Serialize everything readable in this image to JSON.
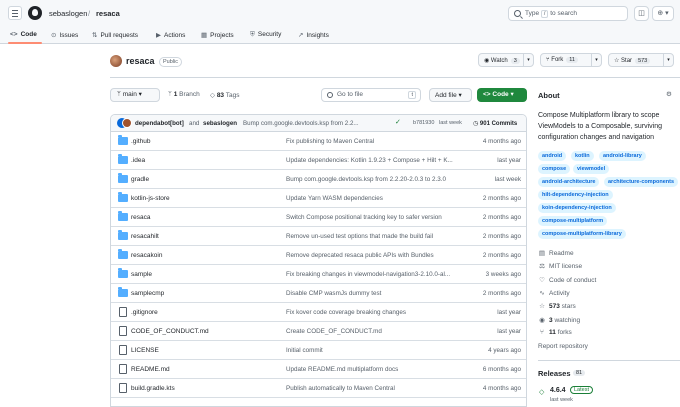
{
  "header": {
    "owner": "sebaslogen",
    "separator": "/",
    "repo": "resaca",
    "search_prefix": "Type",
    "search_key": "/",
    "search_suffix": "to search"
  },
  "tabs": [
    {
      "icon": "<>",
      "label": "Code"
    },
    {
      "icon": "⊙",
      "label": "Issues"
    },
    {
      "icon": "⇅",
      "label": "Pull requests"
    },
    {
      "icon": "▶",
      "label": "Actions"
    },
    {
      "icon": "▦",
      "label": "Projects"
    },
    {
      "icon": "⛨",
      "label": "Security"
    },
    {
      "icon": "↗",
      "label": "Insights"
    }
  ],
  "repo_header": {
    "name": "resaca",
    "visibility": "Public",
    "watch_label": "Watch",
    "watch_count": "3",
    "fork_label": "Fork",
    "fork_count": "11",
    "star_label": "Star",
    "star_count": "573"
  },
  "toolbar": {
    "branch": "main",
    "branch_count": "1",
    "branch_label": "Branch",
    "tag_count": "83",
    "tag_label": "Tags",
    "goto_placeholder": "Go to file",
    "goto_key": "t",
    "add_file": "Add file",
    "code": "Code"
  },
  "latest_commit": {
    "author1": "dependabot[bot]",
    "and": "and",
    "author2": "sebaslogen",
    "message": "Bump com.google.devtools.ksp from 2.2...",
    "hash": "b781930",
    "time": "last week",
    "commits": "901 Commits"
  },
  "files": [
    {
      "type": "folder",
      "name": ".github",
      "message": "Fix publishing to Maven Central",
      "date": "4 months ago"
    },
    {
      "type": "folder",
      "name": ".idea",
      "message": "Update dependencies: Kotlin 1.9.23 + Compose + Hilt + K...",
      "date": "last year"
    },
    {
      "type": "folder",
      "name": "gradle",
      "message": "Bump com.google.devtools.ksp from 2.2.20-2.0.3 to 2.3.0",
      "date": "last week"
    },
    {
      "type": "folder",
      "name": "kotlin-js-store",
      "message": "Update Yarn WASM dependencies",
      "date": "2 months ago"
    },
    {
      "type": "folder",
      "name": "resaca",
      "message": "Switch Compose positional tracking key to safer version",
      "date": "2 months ago"
    },
    {
      "type": "folder",
      "name": "resacahilt",
      "message": "Remove un-used test options that made the build fail",
      "date": "2 months ago"
    },
    {
      "type": "folder",
      "name": "resacakoin",
      "message": "Remove deprecated resaca public APIs with Bundles",
      "date": "2 months ago"
    },
    {
      "type": "folder",
      "name": "sample",
      "message": "Fix breaking changes in viewmodel-navigation3-2.10.0-al...",
      "date": "3 weeks ago"
    },
    {
      "type": "folder",
      "name": "samplecmp",
      "message": "Disable CMP wasmJs dummy test",
      "date": "2 months ago"
    },
    {
      "type": "file",
      "name": ".gitignore",
      "message": "Fix kover code coverage breaking changes",
      "date": "last year"
    },
    {
      "type": "file",
      "name": "CODE_OF_CONDUCT.md",
      "message": "Create CODE_OF_CONDUCT.md",
      "date": "last year"
    },
    {
      "type": "file",
      "name": "LICENSE",
      "message": "Initial commit",
      "date": "4 years ago"
    },
    {
      "type": "file",
      "name": "README.md",
      "message": "Update README.md multiplatform docs",
      "date": "6 months ago"
    },
    {
      "type": "file",
      "name": "build.gradle.kts",
      "message": "Publish automatically to Maven Central",
      "date": "4 months ago"
    }
  ],
  "about": {
    "title": "About",
    "description": "Compose Multiplatform library to scope ViewModels to a Composable, surviving configuration changes and navigation",
    "topics": [
      "android",
      "kotlin",
      "android-library",
      "compose",
      "viewmodel",
      "android-architecture",
      "architecture-components",
      "hilt-dependency-injection",
      "koin-dependency-injection",
      "compose-multiplatform",
      "compose-multiplatform-library"
    ],
    "readme": "Readme",
    "license": "MIT license",
    "conduct": "Code of conduct",
    "activity": "Activity",
    "stars_count": "573",
    "stars_label": "stars",
    "watching_count": "3",
    "watching_label": "watching",
    "forks_count": "11",
    "forks_label": "forks",
    "report": "Report repository"
  },
  "releases": {
    "title": "Releases",
    "count": "81",
    "version": "4.6.4",
    "badge": "Latest",
    "date": "last week"
  },
  "colors": {
    "accent_green": "#1f883d",
    "link_blue": "#0969da",
    "folder_blue": "#54aeff",
    "tab_underline": "#fd8c73"
  }
}
